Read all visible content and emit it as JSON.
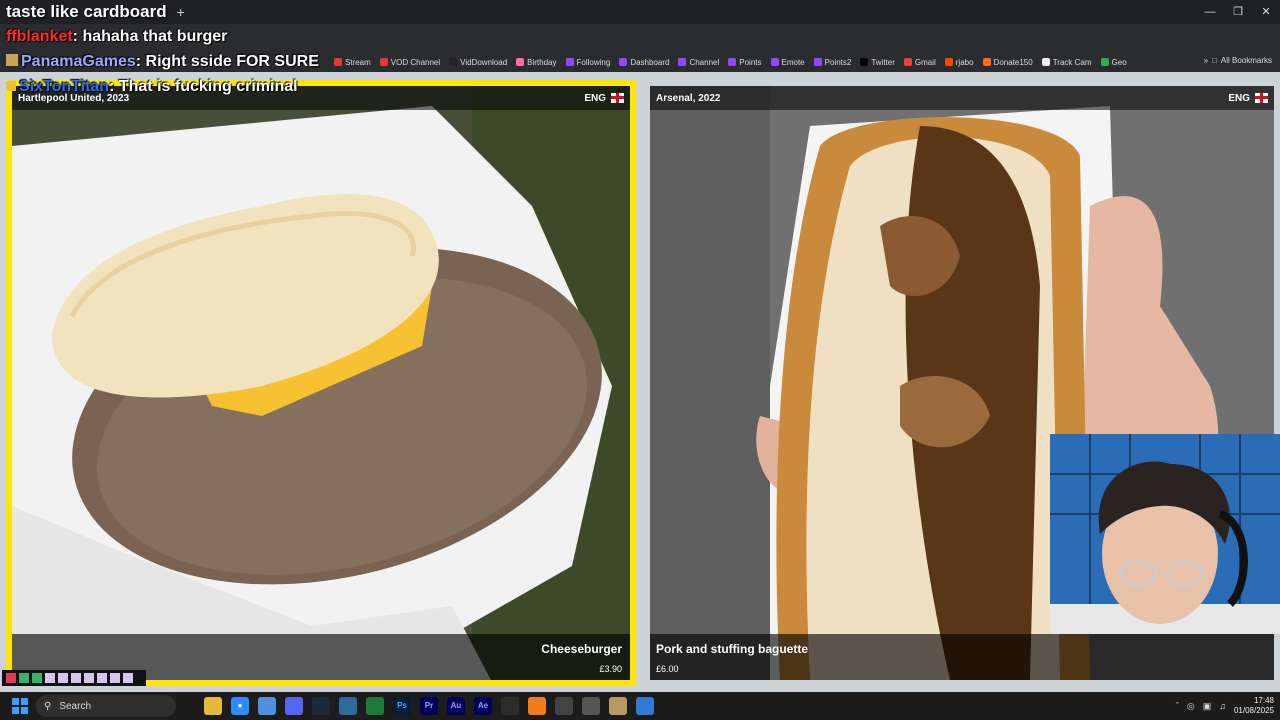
{
  "window": {
    "tab_title": "taste like cardboard",
    "new_tab": "+"
  },
  "chat": [
    {
      "user": "ffblanket",
      "sep": ":",
      "text": "hahaha that burger",
      "color": "#ff2a2a"
    },
    {
      "user": "PanamaGames",
      "sep": ":",
      "text": "Right sside FOR SURE",
      "color": "#9aa8ff"
    },
    {
      "user": "SixTonTitan",
      "sep": ":",
      "text": "That is fucking criminal",
      "color": "#2a6cff"
    }
  ],
  "bookmarks": [
    {
      "label": "Stream",
      "color": "#e53935"
    },
    {
      "label": "VOD Channel",
      "color": "#e53935"
    },
    {
      "label": "VidDownload",
      "color": "#222222"
    },
    {
      "label": "Birthday",
      "color": "#ff6fa5"
    },
    {
      "label": "Following",
      "color": "#9146ff"
    },
    {
      "label": "Dashboard",
      "color": "#9146ff"
    },
    {
      "label": "Channel",
      "color": "#9146ff"
    },
    {
      "label": "Points",
      "color": "#9146ff"
    },
    {
      "label": "Emote",
      "color": "#9146ff"
    },
    {
      "label": "Points2",
      "color": "#9146ff"
    },
    {
      "label": "Twitter",
      "color": "#000000"
    },
    {
      "label": "Gmail",
      "color": "#ea4335"
    },
    {
      "label": "rjabo",
      "color": "#ff4500"
    },
    {
      "label": "Donate150",
      "color": "#ff6a13"
    },
    {
      "label": "Track Cam",
      "color": "#eeeeee"
    },
    {
      "label": "Geo",
      "color": "#34a853"
    }
  ],
  "all_bookmarks": "All Bookmarks",
  "left": {
    "club": "Hartlepool United, 2023",
    "country": "ENG",
    "item": "Cheeseburger",
    "price": "£3.90"
  },
  "right": {
    "club": "Arsenal, 2022",
    "country": "ENG",
    "item": "Pork and stuffing baguette",
    "price": "£6.00"
  },
  "taskbar": {
    "search": "Search",
    "time": "17:48",
    "date": "01/08/2025"
  },
  "colors": {
    "accent_border": "#ffe600"
  }
}
